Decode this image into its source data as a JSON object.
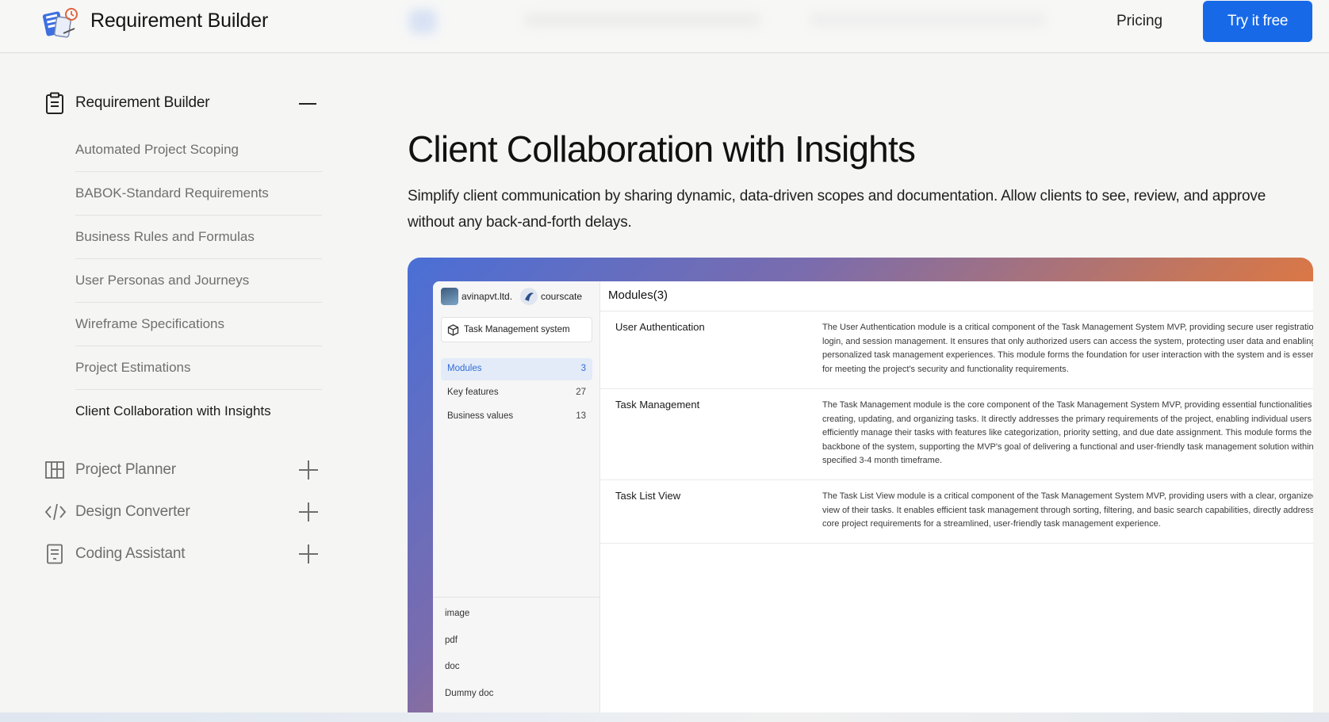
{
  "header": {
    "brand": "Requirement Builder",
    "pricing": "Pricing",
    "cta": "Try it free"
  },
  "sidebar": {
    "section": {
      "label": "Requirement Builder",
      "items": [
        "Automated Project Scoping",
        "BABOK-Standard Requirements",
        "Business Rules and Formulas",
        "User Personas and Journeys",
        "Wireframe Specifications",
        "Project Estimations",
        "Client Collaboration with Insights"
      ]
    },
    "groups": [
      {
        "label": "Project Planner",
        "icon": "grid-icon"
      },
      {
        "label": "Design Converter",
        "icon": "code-icon"
      },
      {
        "label": "Coding Assistant",
        "icon": "document-icon"
      }
    ]
  },
  "main": {
    "title": "Client Collaboration with Insights",
    "description": "Simplify client communication by sharing dynamic, data-driven scopes and documentation. Allow clients to see, review, and approve without any back-and-forth delays."
  },
  "preview": {
    "orgs": [
      "avinapvt.ltd.",
      "courscate"
    ],
    "project": "Task Management system",
    "nav": [
      {
        "label": "Modules",
        "count": "3"
      },
      {
        "label": "Key features",
        "count": "27"
      },
      {
        "label": "Business values",
        "count": "13"
      }
    ],
    "files": [
      "image",
      "pdf",
      "doc",
      "Dummy doc"
    ],
    "modules_title": "Modules(3)",
    "modules": [
      {
        "name": "User Authentication",
        "desc": "The User Authentication module is a critical component of the Task Management System MVP, providing secure user registration, login, and session management. It ensures that only authorized users can access the system, protecting user data and enabling personalized task management experiences. This module forms the foundation for user interaction with the system and is essential for meeting the project's security and functionality requirements."
      },
      {
        "name": "Task Management",
        "desc": "The Task Management module is the core component of the Task Management System MVP, providing essential functionalities for creating, updating, and organizing tasks. It directly addresses the primary requirements of the project, enabling individual users to efficiently manage their tasks with features like categorization, priority setting, and due date assignment. This module forms the backbone of the system, supporting the MVP's goal of delivering a functional and user-friendly task management solution within the specified 3-4 month timeframe."
      },
      {
        "name": "Task List View",
        "desc": "The Task List View module is a critical component of the Task Management System MVP, providing users with a clear, organized view of their tasks. It enables efficient task management through sorting, filtering, and basic search capabilities, directly addressing core project requirements for a streamlined, user-friendly task management experience."
      }
    ]
  },
  "colors": {
    "accent": "#1769e8",
    "gradient_start": "#4a6fd6",
    "gradient_end": "#ff7a22",
    "selected_nav": "#2f6cd6"
  }
}
